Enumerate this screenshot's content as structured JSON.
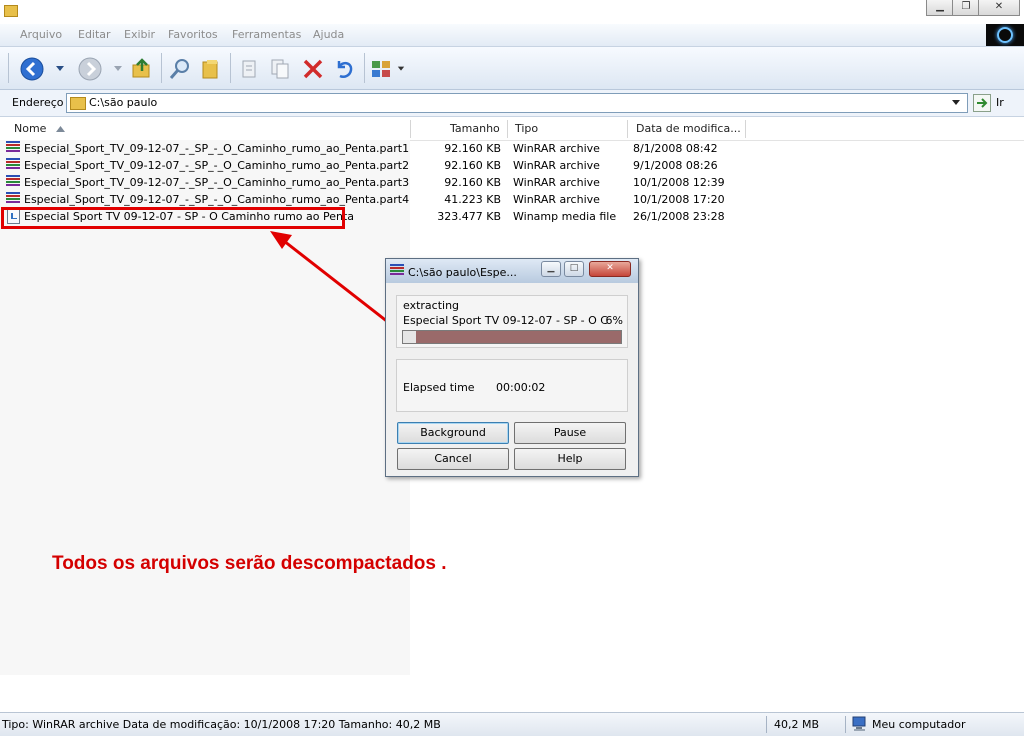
{
  "menu": [
    "Arquivo",
    "Editar",
    "Exibir",
    "Favoritos",
    "Ferramentas",
    "Ajuda"
  ],
  "address": {
    "label": "Endereço",
    "path": "C:\\são paulo",
    "go_label": "Ir"
  },
  "columns": {
    "name": "Nome",
    "size": "Tamanho",
    "type": "Tipo",
    "date": "Data de modifica..."
  },
  "files": [
    {
      "name": "Especial_Sport_TV_09-12-07_-_SP_-_O_Caminho_rumo_ao_Penta.part1",
      "size": "92.160 KB",
      "type": "WinRAR archive",
      "date": "8/1/2008 08:42",
      "icon": "winrar-icon"
    },
    {
      "name": "Especial_Sport_TV_09-12-07_-_SP_-_O_Caminho_rumo_ao_Penta.part2",
      "size": "92.160 KB",
      "type": "WinRAR archive",
      "date": "9/1/2008 08:26",
      "icon": "winrar-icon"
    },
    {
      "name": "Especial_Sport_TV_09-12-07_-_SP_-_O_Caminho_rumo_ao_Penta.part3",
      "size": "92.160 KB",
      "type": "WinRAR archive",
      "date": "10/1/2008 12:39",
      "icon": "winrar-icon"
    },
    {
      "name": "Especial_Sport_TV_09-12-07_-_SP_-_O_Caminho_rumo_ao_Penta.part4",
      "size": "41.223 KB",
      "type": "WinRAR archive",
      "date": "10/1/2008 17:20",
      "icon": "winrar-icon"
    },
    {
      "name": "Especial Sport TV 09-12-07 - SP - O Caminho rumo ao Penta",
      "size": "323.477 KB",
      "type": "Winamp media file",
      "date": "26/1/2008 23:28",
      "icon": "media-file-icon"
    }
  ],
  "dialog": {
    "title": "C:\\são paulo\\Espe...",
    "action": "extracting",
    "current_file": "Especial Sport TV 09-12-07 - SP - O C",
    "percent_label": "6%",
    "progress": 0.06,
    "elapsed_label": "Elapsed time",
    "elapsed_value": "00:00:02",
    "buttons": {
      "background": "Background",
      "pause": "Pause",
      "cancel": "Cancel",
      "help": "Help"
    }
  },
  "annotation": {
    "caption": "Todos os arquivos serão descompactados .",
    "color": "#d40000"
  },
  "status": {
    "info": "Tipo: WinRAR archive Data de modificação: 10/1/2008 17:20 Tamanho: 40,2 MB",
    "size": "40,2 MB",
    "location": "Meu computador"
  }
}
